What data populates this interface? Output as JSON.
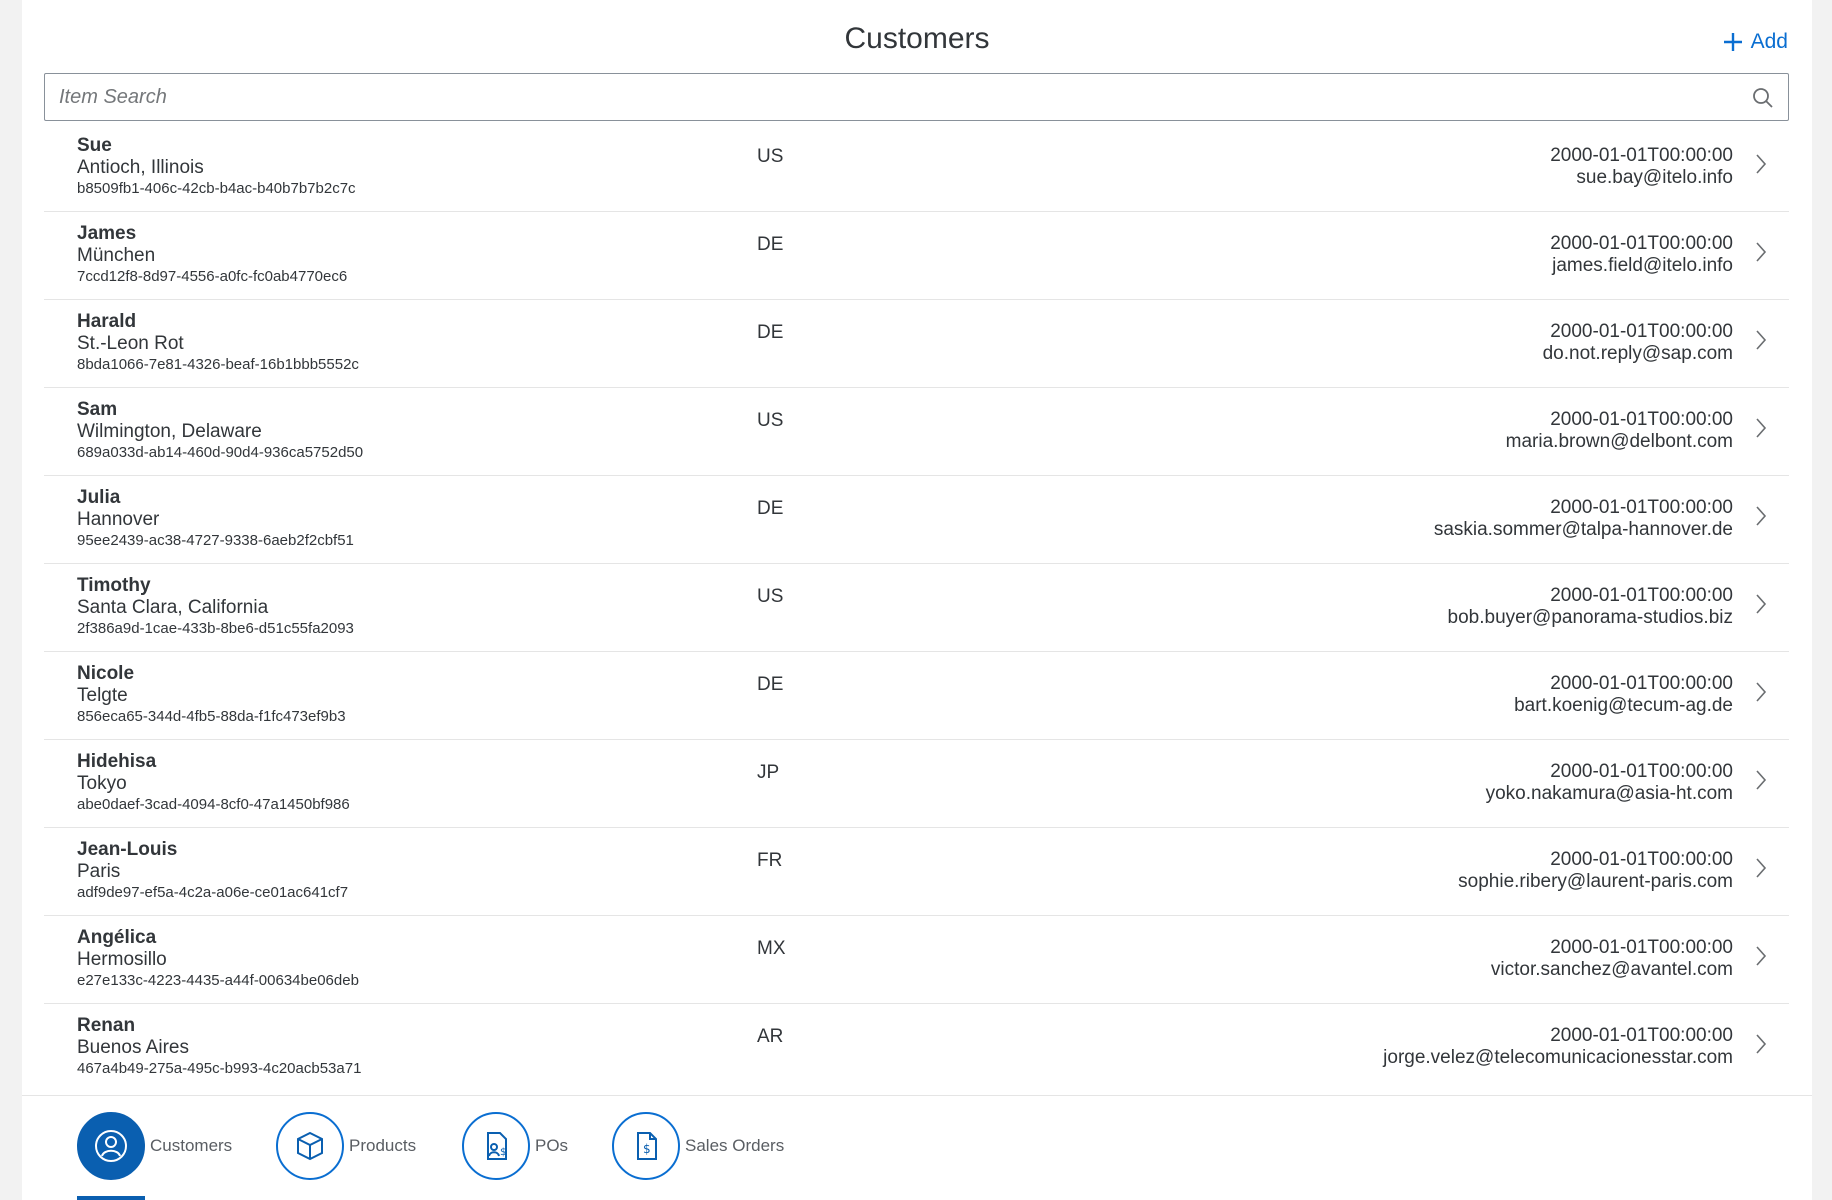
{
  "header": {
    "title": "Customers",
    "add_label": "Add"
  },
  "search": {
    "placeholder": "Item Search"
  },
  "customers": [
    {
      "name": "Sue",
      "city": "Antioch, Illinois",
      "id": "b8509fb1-406c-42cb-b4ac-b40b7b7b2c7c",
      "country": "US",
      "date": "2000-01-01T00:00:00",
      "email": "sue.bay@itelo.info"
    },
    {
      "name": "James",
      "city": "München",
      "id": "7ccd12f8-8d97-4556-a0fc-fc0ab4770ec6",
      "country": "DE",
      "date": "2000-01-01T00:00:00",
      "email": "james.field@itelo.info"
    },
    {
      "name": "Harald",
      "city": "St.-Leon Rot",
      "id": "8bda1066-7e81-4326-beaf-16b1bbb5552c",
      "country": "DE",
      "date": "2000-01-01T00:00:00",
      "email": "do.not.reply@sap.com"
    },
    {
      "name": "Sam",
      "city": "Wilmington, Delaware",
      "id": "689a033d-ab14-460d-90d4-936ca5752d50",
      "country": "US",
      "date": "2000-01-01T00:00:00",
      "email": "maria.brown@delbont.com"
    },
    {
      "name": "Julia",
      "city": "Hannover",
      "id": "95ee2439-ac38-4727-9338-6aeb2f2cbf51",
      "country": "DE",
      "date": "2000-01-01T00:00:00",
      "email": "saskia.sommer@talpa-hannover.de"
    },
    {
      "name": "Timothy",
      "city": "Santa Clara, California",
      "id": "2f386a9d-1cae-433b-8be6-d51c55fa2093",
      "country": "US",
      "date": "2000-01-01T00:00:00",
      "email": "bob.buyer@panorama-studios.biz"
    },
    {
      "name": "Nicole",
      "city": "Telgte",
      "id": "856eca65-344d-4fb5-88da-f1fc473ef9b3",
      "country": "DE",
      "date": "2000-01-01T00:00:00",
      "email": "bart.koenig@tecum-ag.de"
    },
    {
      "name": "Hidehisa",
      "city": "Tokyo",
      "id": "abe0daef-3cad-4094-8cf0-47a1450bf986",
      "country": "JP",
      "date": "2000-01-01T00:00:00",
      "email": "yoko.nakamura@asia-ht.com"
    },
    {
      "name": "Jean-Louis",
      "city": "Paris",
      "id": "adf9de97-ef5a-4c2a-a06e-ce01ac641cf7",
      "country": "FR",
      "date": "2000-01-01T00:00:00",
      "email": "sophie.ribery@laurent-paris.com"
    },
    {
      "name": "Angélica",
      "city": "Hermosillo",
      "id": "e27e133c-4223-4435-a44f-00634be06deb",
      "country": "MX",
      "date": "2000-01-01T00:00:00",
      "email": "victor.sanchez@avantel.com"
    },
    {
      "name": "Renan",
      "city": "Buenos Aires",
      "id": "467a4b49-275a-495c-b993-4c20acb53a71",
      "country": "AR",
      "date": "2000-01-01T00:00:00",
      "email": "jorge.velez@telecomunicacionesstar.com"
    }
  ],
  "tabs": [
    {
      "label": "Customers",
      "icon": "customer-icon",
      "active": true
    },
    {
      "label": "Products",
      "icon": "product-icon",
      "active": false
    },
    {
      "label": "POs",
      "icon": "purchase-order-icon",
      "active": false
    },
    {
      "label": "Sales Orders",
      "icon": "sales-order-icon",
      "active": false
    }
  ],
  "colors": {
    "accent": "#0a6ed1",
    "active_tab": "#0a5fb0",
    "text": "#32363a"
  }
}
